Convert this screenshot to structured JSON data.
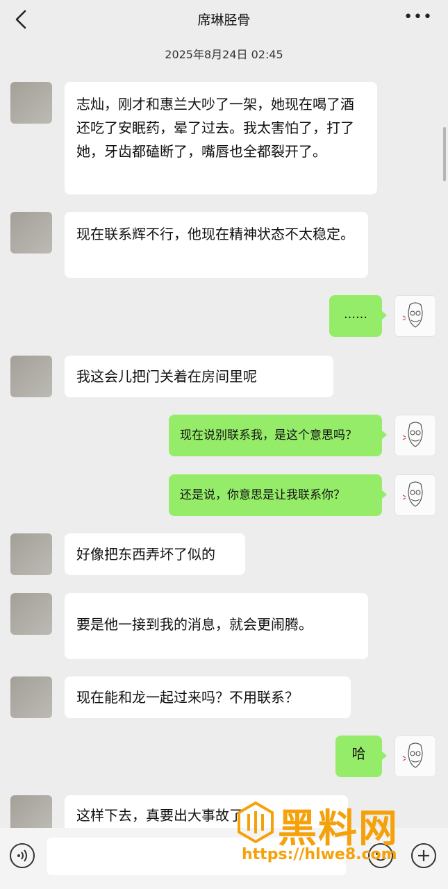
{
  "header": {
    "title": "席琳胫骨",
    "more_label": "•••"
  },
  "timestamp": "2025年8月24日 02:45",
  "messages": [
    {
      "side": "left",
      "text": "志灿，刚才和惠兰大吵了一架，她现在喝了酒还吃了安眠药，晕了过去。我太害怕了，打了她，牙齿都磕断了，嘴唇也全都裂开了。"
    },
    {
      "side": "left",
      "text": "现在联系辉不行，他现在精神状态不太稳定。"
    },
    {
      "side": "right",
      "text": "……"
    },
    {
      "side": "left",
      "text": "我这会儿把门关着在房间里呢"
    },
    {
      "side": "right",
      "text": "现在说别联系我，是这个意思吗？"
    },
    {
      "side": "right",
      "text": "还是说，你意思是让我联系你？"
    },
    {
      "side": "left",
      "text": "好像把东西弄坏了似的"
    },
    {
      "side": "left",
      "text": "要是他一接到我的消息，就会更闹腾。"
    },
    {
      "side": "left",
      "text": "现在能和龙一起过来吗？不用联系？"
    },
    {
      "side": "right",
      "text": "哈"
    },
    {
      "side": "left",
      "text": "这样下去，真要出大事故了"
    }
  ],
  "watermark": {
    "brand": "黑料网",
    "url": "https://hlwe8.com"
  },
  "colors": {
    "background": "#ededed",
    "bubble_self": "#95ec69",
    "bubble_other": "#ffffff",
    "watermark": "#f5a10a"
  },
  "icons": [
    "back-icon",
    "more-icon",
    "voice-icon",
    "emoji-icon",
    "plus-icon"
  ]
}
